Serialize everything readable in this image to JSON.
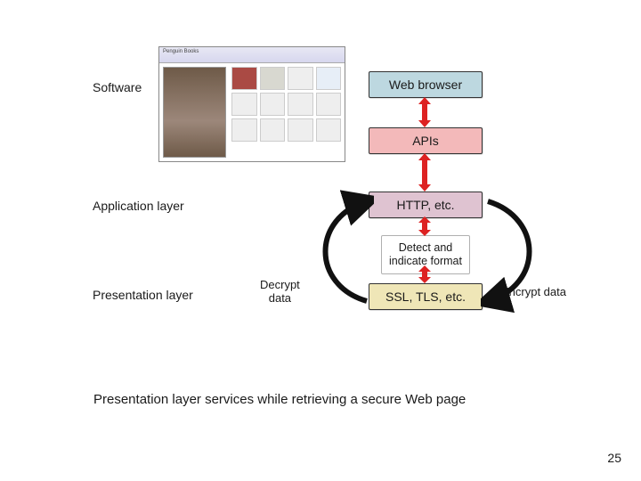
{
  "labels": {
    "software": "Software",
    "application": "Application layer",
    "presentation": "Presentation layer"
  },
  "boxes": {
    "web_browser": "Web browser",
    "apis": "APIs",
    "http": "HTTP, etc.",
    "detect": "Detect and\nindicate format",
    "ssl": "SSL, TLS, etc."
  },
  "annotations": {
    "decrypt": "Decrypt\ndata",
    "encrypt": "Encrypt data"
  },
  "caption": "Presentation layer services while retrieving a secure Web page",
  "page_number": "25",
  "thumb_title": "Penguin Books"
}
